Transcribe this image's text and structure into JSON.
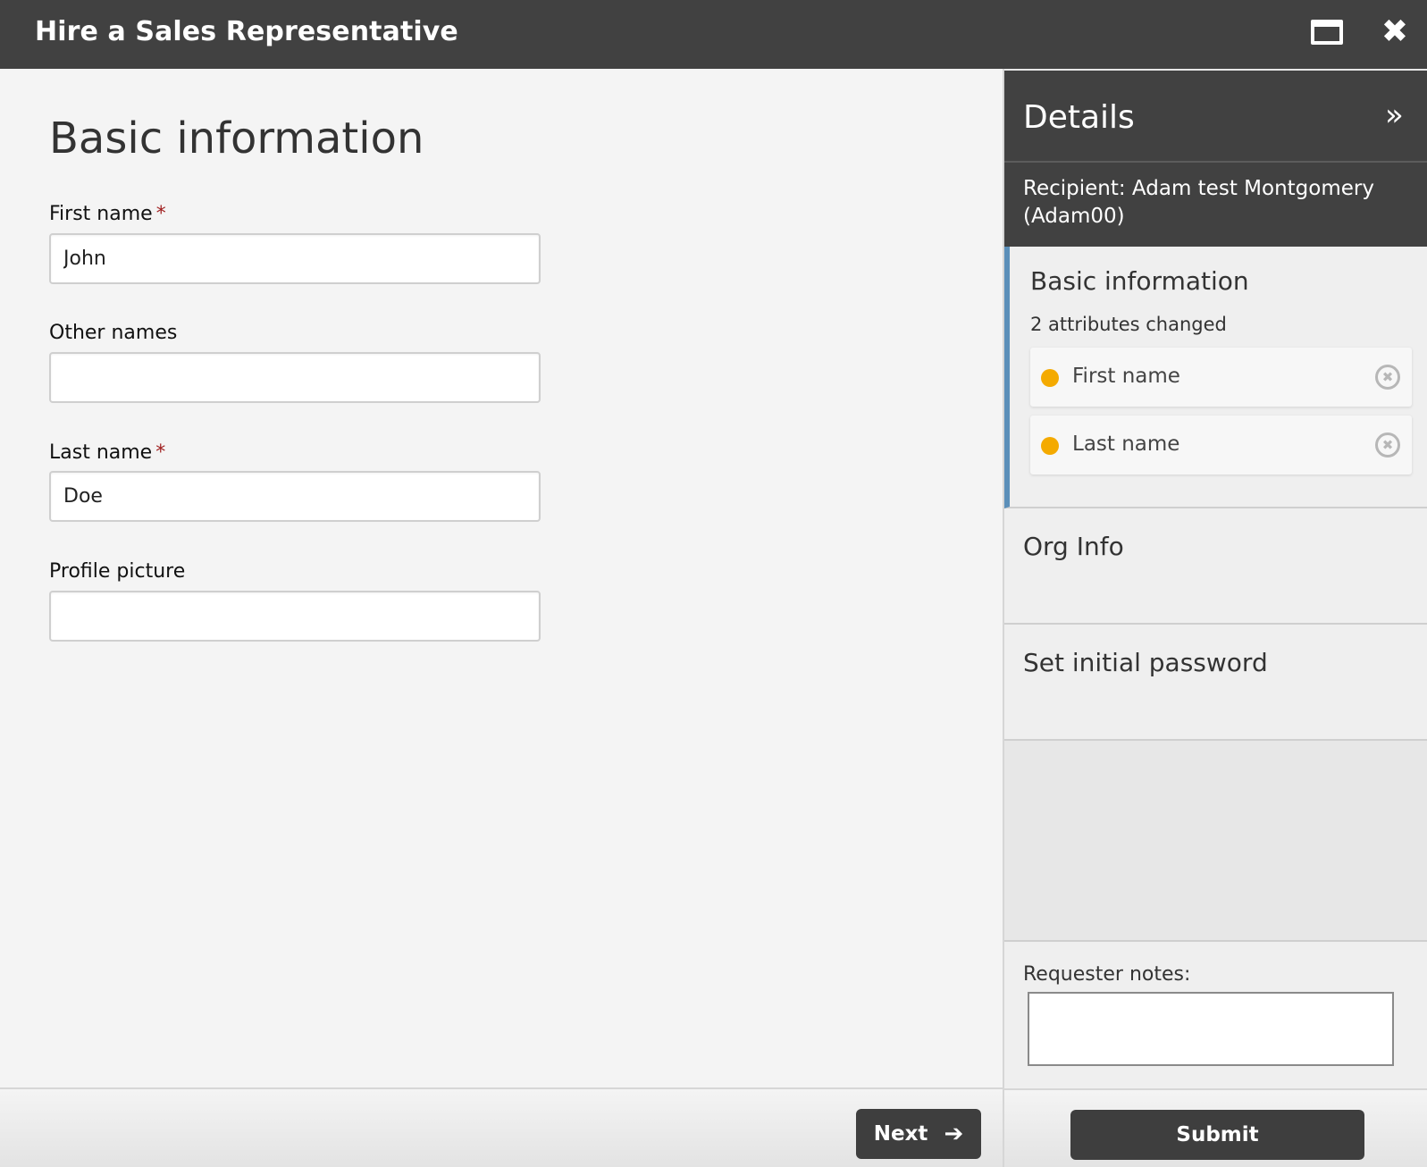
{
  "window": {
    "title": "Hire a Sales Representative",
    "maximize_icon": "window-maximize-icon",
    "close_icon": "close-icon",
    "close_glyph": "✖"
  },
  "form": {
    "heading": "Basic information",
    "required_marker": "*",
    "fields": {
      "first_name": {
        "label": "First name",
        "value": "John",
        "required": true
      },
      "other_names": {
        "label": "Other names",
        "value": "",
        "required": false
      },
      "last_name": {
        "label": "Last name",
        "value": "Doe",
        "required": true
      },
      "profile_picture": {
        "label": "Profile picture",
        "value": "",
        "required": false
      }
    },
    "next_label": "Next",
    "next_icon": "arrow-right-icon",
    "next_glyph": "➔"
  },
  "details": {
    "title": "Details",
    "collapse_icon": "double-chevron-right-icon",
    "collapse_glyph": "»",
    "recipient": "Recipient: Adam test Montgomery (Adam00)",
    "sections": {
      "basic": {
        "title": "Basic information",
        "summary": "2 attributes changed",
        "changed_attributes": [
          {
            "label": "First name",
            "status_color": "#f4aa00",
            "remove_glyph": "✖"
          },
          {
            "label": "Last name",
            "status_color": "#f4aa00",
            "remove_glyph": "✖"
          }
        ]
      },
      "org_info": {
        "title": "Org Info"
      },
      "password": {
        "title": "Set initial password"
      }
    },
    "notes_label": "Requester notes:",
    "notes_value": "",
    "submit_label": "Submit"
  },
  "colors": {
    "titlebar": "#414141",
    "accent_border": "#5b8fb9",
    "changed_dot": "#f4aa00",
    "required_marker": "#a02020"
  }
}
